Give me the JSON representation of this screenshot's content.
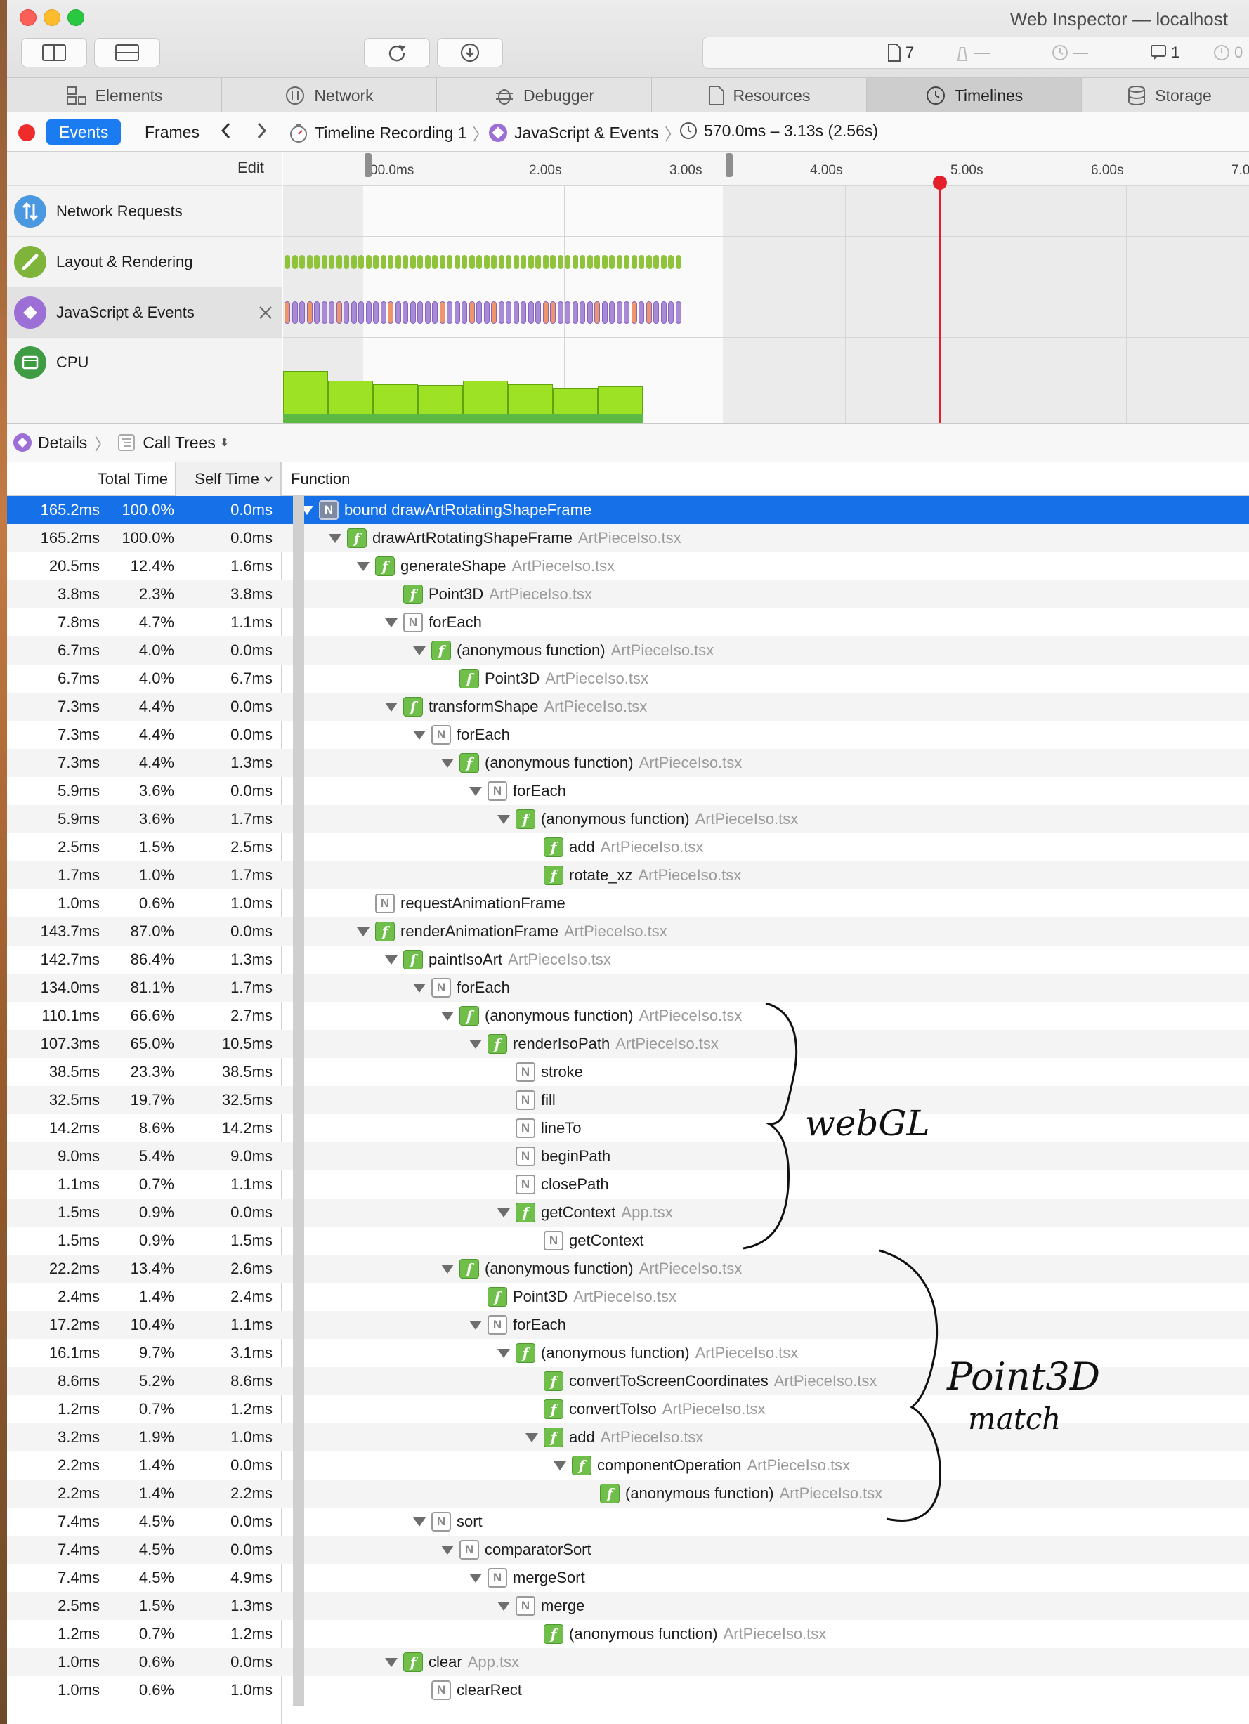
{
  "window": {
    "title": "Web Inspector — localhost"
  },
  "dashboard": {
    "resources": "7",
    "network": "—",
    "load": "—",
    "console": "1",
    "errors": "0"
  },
  "tabs": [
    {
      "label": "Elements",
      "icon": "elements-icon"
    },
    {
      "label": "Network",
      "icon": "network-icon"
    },
    {
      "label": "Debugger",
      "icon": "debugger-icon"
    },
    {
      "label": "Resources",
      "icon": "resources-icon"
    },
    {
      "label": "Timelines",
      "icon": "timelines-icon",
      "selected": true
    },
    {
      "label": "Storage",
      "icon": "storage-icon"
    }
  ],
  "nav": {
    "events": "Events",
    "frames": "Frames",
    "recording": "Timeline Recording 1",
    "timeline": "JavaScript & Events",
    "range": "570.0ms – 3.13s (2.56s)"
  },
  "overview": {
    "edit": "Edit",
    "ticks": [
      "00.0ms",
      "2.00s",
      "3.00s",
      "4.00s",
      "5.00s",
      "6.00s",
      "7.00"
    ],
    "lanes": [
      "Network Requests",
      "Layout & Rendering",
      "JavaScript & Events",
      "CPU"
    ],
    "colors": {
      "layout": "#8fc43a",
      "script": "#a98ad6",
      "script_hot": "#f0956b",
      "cpu": "#9de224",
      "playhead": "#e3202b"
    },
    "cpu_levels": [
      0.62,
      0.5,
      0.46,
      0.45,
      0.5,
      0.46,
      0.41,
      0.43
    ]
  },
  "details": {
    "label": "Details",
    "view": "Call Trees"
  },
  "columns": {
    "total": "Total Time",
    "self": "Self Time",
    "function": "Function"
  },
  "rows": [
    {
      "total": "165.2ms",
      "pct": "100.0%",
      "self": "0.0ms",
      "depth": 0,
      "exp": true,
      "icon": "N",
      "name": "bound drawArtRotatingShapeFrame",
      "file": ""
    },
    {
      "total": "165.2ms",
      "pct": "100.0%",
      "self": "0.0ms",
      "depth": 1,
      "exp": true,
      "icon": "f",
      "name": "drawArtRotatingShapeFrame",
      "file": "ArtPieceIso.tsx"
    },
    {
      "total": "20.5ms",
      "pct": "12.4%",
      "self": "1.6ms",
      "depth": 2,
      "exp": true,
      "icon": "f",
      "name": "generateShape",
      "file": "ArtPieceIso.tsx"
    },
    {
      "total": "3.8ms",
      "pct": "2.3%",
      "self": "3.8ms",
      "depth": 3,
      "exp": false,
      "icon": "f",
      "name": "Point3D",
      "file": "ArtPieceIso.tsx"
    },
    {
      "total": "7.8ms",
      "pct": "4.7%",
      "self": "1.1ms",
      "depth": 3,
      "exp": true,
      "icon": "N",
      "name": "forEach",
      "file": ""
    },
    {
      "total": "6.7ms",
      "pct": "4.0%",
      "self": "0.0ms",
      "depth": 4,
      "exp": true,
      "icon": "f",
      "name": "(anonymous function)",
      "file": "ArtPieceIso.tsx"
    },
    {
      "total": "6.7ms",
      "pct": "4.0%",
      "self": "6.7ms",
      "depth": 5,
      "exp": false,
      "icon": "f",
      "name": "Point3D",
      "file": "ArtPieceIso.tsx"
    },
    {
      "total": "7.3ms",
      "pct": "4.4%",
      "self": "0.0ms",
      "depth": 3,
      "exp": true,
      "icon": "f",
      "name": "transformShape",
      "file": "ArtPieceIso.tsx"
    },
    {
      "total": "7.3ms",
      "pct": "4.4%",
      "self": "0.0ms",
      "depth": 4,
      "exp": true,
      "icon": "N",
      "name": "forEach",
      "file": ""
    },
    {
      "total": "7.3ms",
      "pct": "4.4%",
      "self": "1.3ms",
      "depth": 5,
      "exp": true,
      "icon": "f",
      "name": "(anonymous function)",
      "file": "ArtPieceIso.tsx"
    },
    {
      "total": "5.9ms",
      "pct": "3.6%",
      "self": "0.0ms",
      "depth": 6,
      "exp": true,
      "icon": "N",
      "name": "forEach",
      "file": ""
    },
    {
      "total": "5.9ms",
      "pct": "3.6%",
      "self": "1.7ms",
      "depth": 7,
      "exp": true,
      "icon": "f",
      "name": "(anonymous function)",
      "file": "ArtPieceIso.tsx"
    },
    {
      "total": "2.5ms",
      "pct": "1.5%",
      "self": "2.5ms",
      "depth": 8,
      "exp": false,
      "icon": "f",
      "name": "add",
      "file": "ArtPieceIso.tsx"
    },
    {
      "total": "1.7ms",
      "pct": "1.0%",
      "self": "1.7ms",
      "depth": 8,
      "exp": false,
      "icon": "f",
      "name": "rotate_xz",
      "file": "ArtPieceIso.tsx"
    },
    {
      "total": "1.0ms",
      "pct": "0.6%",
      "self": "1.0ms",
      "depth": 2,
      "exp": false,
      "icon": "N",
      "name": "requestAnimationFrame",
      "file": ""
    },
    {
      "total": "143.7ms",
      "pct": "87.0%",
      "self": "0.0ms",
      "depth": 2,
      "exp": true,
      "icon": "f",
      "name": "renderAnimationFrame",
      "file": "ArtPieceIso.tsx"
    },
    {
      "total": "142.7ms",
      "pct": "86.4%",
      "self": "1.3ms",
      "depth": 3,
      "exp": true,
      "icon": "f",
      "name": "paintIsoArt",
      "file": "ArtPieceIso.tsx"
    },
    {
      "total": "134.0ms",
      "pct": "81.1%",
      "self": "1.7ms",
      "depth": 4,
      "exp": true,
      "icon": "N",
      "name": "forEach",
      "file": ""
    },
    {
      "total": "110.1ms",
      "pct": "66.6%",
      "self": "2.7ms",
      "depth": 5,
      "exp": true,
      "icon": "f",
      "name": "(anonymous function)",
      "file": "ArtPieceIso.tsx"
    },
    {
      "total": "107.3ms",
      "pct": "65.0%",
      "self": "10.5ms",
      "depth": 6,
      "exp": true,
      "icon": "f",
      "name": "renderIsoPath",
      "file": "ArtPieceIso.tsx"
    },
    {
      "total": "38.5ms",
      "pct": "23.3%",
      "self": "38.5ms",
      "depth": 7,
      "exp": false,
      "icon": "N",
      "name": "stroke",
      "file": ""
    },
    {
      "total": "32.5ms",
      "pct": "19.7%",
      "self": "32.5ms",
      "depth": 7,
      "exp": false,
      "icon": "N",
      "name": "fill",
      "file": ""
    },
    {
      "total": "14.2ms",
      "pct": "8.6%",
      "self": "14.2ms",
      "depth": 7,
      "exp": false,
      "icon": "N",
      "name": "lineTo",
      "file": ""
    },
    {
      "total": "9.0ms",
      "pct": "5.4%",
      "self": "9.0ms",
      "depth": 7,
      "exp": false,
      "icon": "N",
      "name": "beginPath",
      "file": ""
    },
    {
      "total": "1.1ms",
      "pct": "0.7%",
      "self": "1.1ms",
      "depth": 7,
      "exp": false,
      "icon": "N",
      "name": "closePath",
      "file": ""
    },
    {
      "total": "1.5ms",
      "pct": "0.9%",
      "self": "0.0ms",
      "depth": 7,
      "exp": true,
      "icon": "f",
      "name": "getContext",
      "file": "App.tsx"
    },
    {
      "total": "1.5ms",
      "pct": "0.9%",
      "self": "1.5ms",
      "depth": 8,
      "exp": false,
      "icon": "N",
      "name": "getContext",
      "file": ""
    },
    {
      "total": "22.2ms",
      "pct": "13.4%",
      "self": "2.6ms",
      "depth": 5,
      "exp": true,
      "icon": "f",
      "name": "(anonymous function)",
      "file": "ArtPieceIso.tsx"
    },
    {
      "total": "2.4ms",
      "pct": "1.4%",
      "self": "2.4ms",
      "depth": 6,
      "exp": false,
      "icon": "f",
      "name": "Point3D",
      "file": "ArtPieceIso.tsx"
    },
    {
      "total": "17.2ms",
      "pct": "10.4%",
      "self": "1.1ms",
      "depth": 6,
      "exp": true,
      "icon": "N",
      "name": "forEach",
      "file": ""
    },
    {
      "total": "16.1ms",
      "pct": "9.7%",
      "self": "3.1ms",
      "depth": 7,
      "exp": true,
      "icon": "f",
      "name": "(anonymous function)",
      "file": "ArtPieceIso.tsx"
    },
    {
      "total": "8.6ms",
      "pct": "5.2%",
      "self": "8.6ms",
      "depth": 8,
      "exp": false,
      "icon": "f",
      "name": "convertToScreenCoordinates",
      "file": "ArtPieceIso.tsx"
    },
    {
      "total": "1.2ms",
      "pct": "0.7%",
      "self": "1.2ms",
      "depth": 8,
      "exp": false,
      "icon": "f",
      "name": "convertToIso",
      "file": "ArtPieceIso.tsx"
    },
    {
      "total": "3.2ms",
      "pct": "1.9%",
      "self": "1.0ms",
      "depth": 8,
      "exp": true,
      "icon": "f",
      "name": "add",
      "file": "ArtPieceIso.tsx"
    },
    {
      "total": "2.2ms",
      "pct": "1.4%",
      "self": "0.0ms",
      "depth": 9,
      "exp": true,
      "icon": "f",
      "name": "componentOperation",
      "file": "ArtPieceIso.tsx"
    },
    {
      "total": "2.2ms",
      "pct": "1.4%",
      "self": "2.2ms",
      "depth": 10,
      "exp": false,
      "icon": "f",
      "name": "(anonymous function)",
      "file": "ArtPieceIso.tsx"
    },
    {
      "total": "7.4ms",
      "pct": "4.5%",
      "self": "0.0ms",
      "depth": 4,
      "exp": true,
      "icon": "N",
      "name": "sort",
      "file": ""
    },
    {
      "total": "7.4ms",
      "pct": "4.5%",
      "self": "0.0ms",
      "depth": 5,
      "exp": true,
      "icon": "N",
      "name": "comparatorSort",
      "file": ""
    },
    {
      "total": "7.4ms",
      "pct": "4.5%",
      "self": "4.9ms",
      "depth": 6,
      "exp": true,
      "icon": "N",
      "name": "mergeSort",
      "file": ""
    },
    {
      "total": "2.5ms",
      "pct": "1.5%",
      "self": "1.3ms",
      "depth": 7,
      "exp": true,
      "icon": "N",
      "name": "merge",
      "file": ""
    },
    {
      "total": "1.2ms",
      "pct": "0.7%",
      "self": "1.2ms",
      "depth": 8,
      "exp": false,
      "icon": "f",
      "name": "(anonymous function)",
      "file": "ArtPieceIso.tsx"
    },
    {
      "total": "1.0ms",
      "pct": "0.6%",
      "self": "0.0ms",
      "depth": 3,
      "exp": true,
      "icon": "f",
      "name": "clear",
      "file": "App.tsx"
    },
    {
      "total": "1.0ms",
      "pct": "0.6%",
      "self": "1.0ms",
      "depth": 4,
      "exp": false,
      "icon": "N",
      "name": "clearRect",
      "file": ""
    }
  ],
  "annotations": [
    "webGL",
    "Point3D",
    "match"
  ]
}
